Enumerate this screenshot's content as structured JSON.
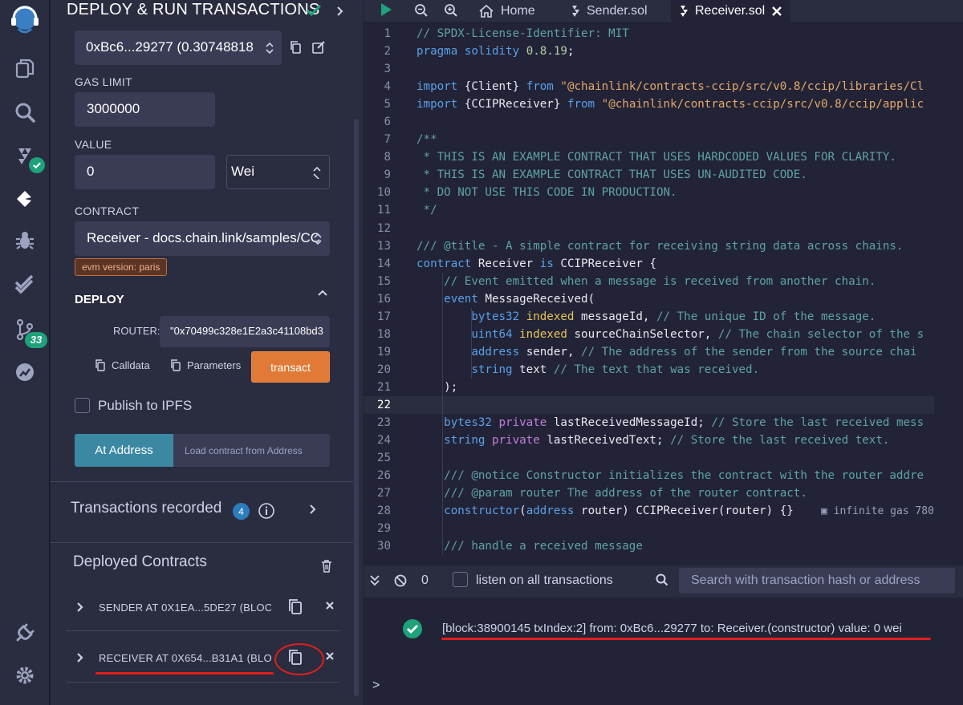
{
  "deploy_panel": {
    "title": "DEPLOY & RUN TRANSACTIONS",
    "account": "0xBc6...29277 (0.30748818",
    "gas_limit_label": "GAS LIMIT",
    "gas_limit": "3000000",
    "value_label": "VALUE",
    "value": "0",
    "value_unit": "Wei",
    "contract_label": "CONTRACT",
    "contract": "Receiver - docs.chain.link/samples/CC",
    "evm_version": "evm version: paris",
    "deploy_label": "DEPLOY",
    "router_label": "ROUTER:",
    "router_value": "\"0x70499c328e1E2a3c41108bd3",
    "calldata_label": "Calldata",
    "parameters_label": "Parameters",
    "transact_label": "transact",
    "publish_label": "Publish to IPFS",
    "at_address_label": "At Address",
    "load_contract_placeholder": "Load contract from Address",
    "transactions_recorded_label": "Transactions recorded",
    "transactions_recorded_count": "4",
    "deployed_contracts_label": "Deployed Contracts",
    "deployed": [
      {
        "name": "SENDER AT 0X1EA...5DE27 (BLOC"
      },
      {
        "name": "RECEIVER AT 0X654...B31A1 (BLO"
      }
    ]
  },
  "rail": {
    "plugin_badge": "33",
    "icons": [
      "remix-logo-icon",
      "file-explorer-icon",
      "search-icon",
      "solidity-compiler-icon",
      "deploy-run-icon",
      "debugger-icon",
      "test-icon",
      "git-icon",
      "analytics-icon",
      "plugin-manager-icon",
      "settings-icon"
    ]
  },
  "editor": {
    "tabs": [
      {
        "label": "Home",
        "icon": "home-icon"
      },
      {
        "label": "Sender.sol",
        "icon": "solidity-icon"
      },
      {
        "label": "Receiver.sol",
        "icon": "solidity-icon",
        "active": true
      }
    ],
    "current_line": 22,
    "lines": [
      "// SPDX-License-Identifier: MIT",
      "pragma solidity 0.8.19;",
      "",
      "import {Client} from \"@chainlink/contracts-ccip/src/v0.8/ccip/libraries/Cl",
      "import {CCIPReceiver} from \"@chainlink/contracts-ccip/src/v0.8/ccip/applic",
      "",
      "/**",
      " * THIS IS AN EXAMPLE CONTRACT THAT USES HARDCODED VALUES FOR CLARITY.",
      " * THIS IS AN EXAMPLE CONTRACT THAT USES UN-AUDITED CODE.",
      " * DO NOT USE THIS CODE IN PRODUCTION.",
      " */",
      "",
      "/// @title - A simple contract for receiving string data across chains.",
      "contract Receiver is CCIPReceiver {",
      "    // Event emitted when a message is received from another chain.",
      "    event MessageReceived(",
      "        bytes32 indexed messageId, // The unique ID of the message.",
      "        uint64 indexed sourceChainSelector, // The chain selector of the s",
      "        address sender, // The address of the sender from the source chai",
      "        string text // The text that was received.",
      "    );",
      "",
      "    bytes32 private lastReceivedMessageId; // Store the last received mess",
      "    string private lastReceivedText; // Store the last received text.",
      "",
      "    /// @notice Constructor initializes the contract with the router addre",
      "    /// @param router The address of the router contract.",
      "    constructor(address router) CCIPReceiver(router) {}",
      "",
      "    /// handle a received message"
    ],
    "gas_hint": "infinite gas 780"
  },
  "terminal": {
    "pending_count": "0",
    "listen_label": "listen on all transactions",
    "search_placeholder": "Search with transaction hash or address",
    "log": "[block:38900145 txIndex:2]  from: 0xBc6...29277 to: Receiver.(constructor) value: 0 wei",
    "prompt": ">"
  }
}
